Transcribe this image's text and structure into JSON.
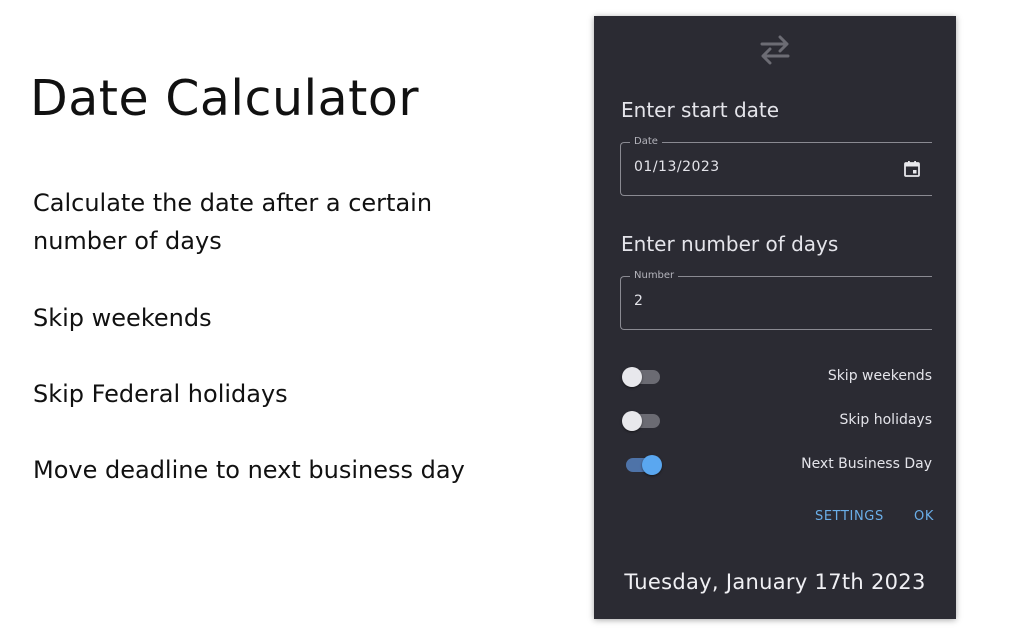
{
  "promo": {
    "title": "Date Calculator",
    "features": [
      "Calculate the date after a certain number of days",
      "Skip weekends",
      "Skip Federal holidays",
      "Move deadline to next business day"
    ]
  },
  "panel": {
    "icons": {
      "swap": "swap-arrows-icon",
      "calendar": "calendar-icon"
    },
    "start_date": {
      "heading": "Enter start date",
      "legend": "Date",
      "value": "01/13/2023"
    },
    "days": {
      "heading": "Enter number of days",
      "legend": "Number",
      "value": "2"
    },
    "toggles": [
      {
        "label": "Skip weekends",
        "on": false
      },
      {
        "label": "Skip holidays",
        "on": false
      },
      {
        "label": "Next Business Day",
        "on": true
      }
    ],
    "actions": {
      "settings": "SETTINGS",
      "ok": "OK"
    },
    "result": "Tuesday, January 17th 2023"
  },
  "colors": {
    "panel_bg": "#2b2b33",
    "accent": "#6aaee8",
    "switch_on": "#5aa7f0"
  }
}
